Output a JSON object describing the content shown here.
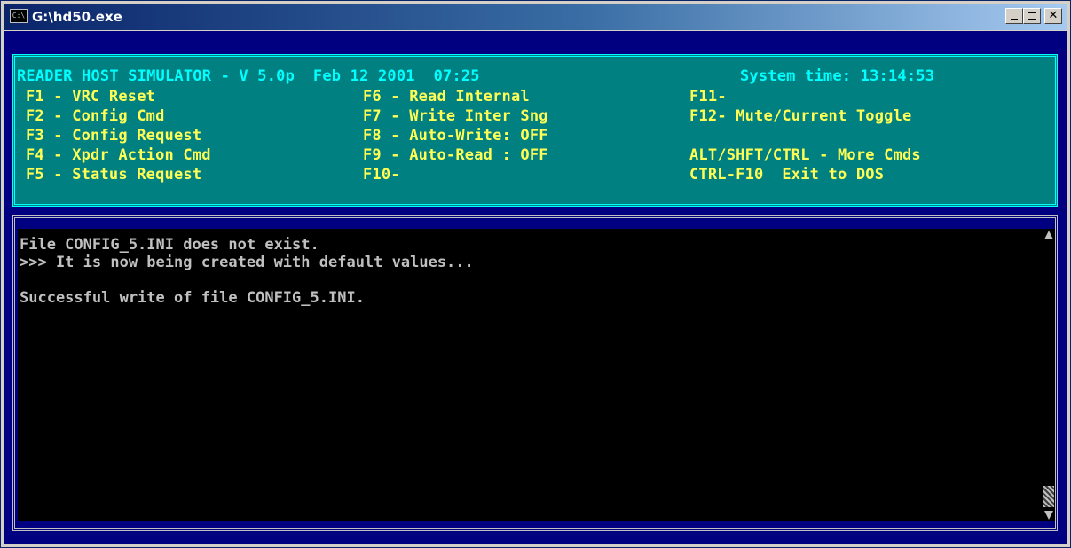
{
  "window": {
    "title": "G:\\hd50.exe",
    "close_glyph": "✕"
  },
  "header": {
    "line1_left": "READER HOST SIMULATOR - V 5.0p  Feb 12 2001  07:25",
    "line1_right": "System time: 13:14:53"
  },
  "commands": [
    {
      "key": "F1",
      "label": "VRC Reset"
    },
    {
      "key": "F2",
      "label": "Config Cmd"
    },
    {
      "key": "F3",
      "label": "Config Request"
    },
    {
      "key": "F4",
      "label": "Xpdr Action Cmd"
    },
    {
      "key": "F5",
      "label": "Status Request"
    },
    {
      "key": "F6",
      "label": "Read Internal"
    },
    {
      "key": "F7",
      "label": "Write Inter Sng"
    },
    {
      "key": "F8",
      "label": "Auto-Write: OFF"
    },
    {
      "key": "F9",
      "label": "Auto-Read : OFF"
    },
    {
      "key": "F10",
      "label": ""
    },
    {
      "key": "F11",
      "label": ""
    },
    {
      "key": "F12",
      "label": "Mute/Current Toggle"
    }
  ],
  "extra": {
    "more_cmds": "ALT/SHFT/CTRL - More Cmds",
    "exit": "CTRL-F10  Exit to DOS"
  },
  "console": {
    "lines": [
      "File CONFIG_5.INI does not exist.",
      ">>> It is now being created with default values...",
      "",
      "Successful write of file CONFIG_5.INI."
    ]
  },
  "colors": {
    "panel_bg": "#008080",
    "header_text": "#00ffff",
    "command_text": "#ffff55",
    "console_text": "#c0c0c0",
    "client_bg": "#000080"
  }
}
